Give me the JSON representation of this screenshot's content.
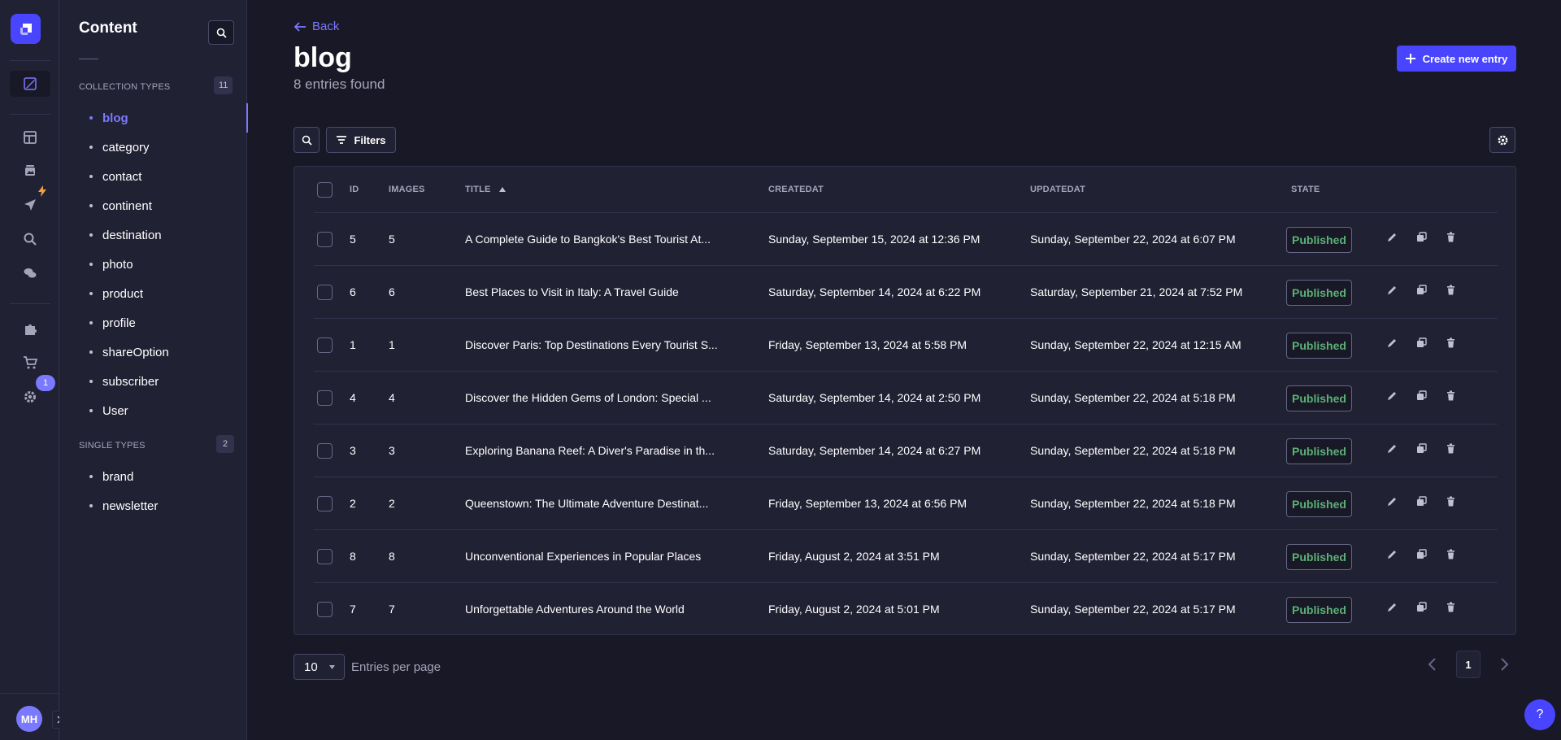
{
  "rail": {
    "badge": "1",
    "avatar_initials": "MH"
  },
  "sidebar": {
    "title": "Content",
    "collection_types_label": "COLLECTION TYPES",
    "collection_types_count": "11",
    "collection_types": [
      "blog",
      "category",
      "contact",
      "continent",
      "destination",
      "photo",
      "product",
      "profile",
      "shareOption",
      "subscriber",
      "User"
    ],
    "single_types_label": "SINGLE TYPES",
    "single_types_count": "2",
    "single_types": [
      "brand",
      "newsletter"
    ],
    "active_item": "blog"
  },
  "header": {
    "back_label": "Back",
    "title": "blog",
    "subtitle": "8 entries found",
    "create_label": "Create new entry"
  },
  "toolbar": {
    "filters_label": "Filters"
  },
  "table": {
    "columns": [
      "ID",
      "IMAGES",
      "TITLE",
      "CREATEDAT",
      "UPDATEDAT",
      "STATE"
    ],
    "rows": [
      {
        "id": "5",
        "images": "5",
        "title": "A Complete Guide to Bangkok's Best Tourist At...",
        "created": "Sunday, September 15, 2024 at 12:36 PM",
        "updated": "Sunday, September 22, 2024 at 6:07 PM",
        "state": "Published"
      },
      {
        "id": "6",
        "images": "6",
        "title": "Best Places to Visit in Italy: A Travel Guide",
        "created": "Saturday, September 14, 2024 at 6:22 PM",
        "updated": "Saturday, September 21, 2024 at 7:52 PM",
        "state": "Published"
      },
      {
        "id": "1",
        "images": "1",
        "title": "Discover Paris: Top Destinations Every Tourist S...",
        "created": "Friday, September 13, 2024 at 5:58 PM",
        "updated": "Sunday, September 22, 2024 at 12:15 AM",
        "state": "Published"
      },
      {
        "id": "4",
        "images": "4",
        "title": "Discover the Hidden Gems of London: Special ...",
        "created": "Saturday, September 14, 2024 at 2:50 PM",
        "updated": "Sunday, September 22, 2024 at 5:18 PM",
        "state": "Published"
      },
      {
        "id": "3",
        "images": "3",
        "title": "Exploring Banana Reef: A Diver's Paradise in th...",
        "created": "Saturday, September 14, 2024 at 6:27 PM",
        "updated": "Sunday, September 22, 2024 at 5:18 PM",
        "state": "Published"
      },
      {
        "id": "2",
        "images": "2",
        "title": "Queenstown: The Ultimate Adventure Destinat...",
        "created": "Friday, September 13, 2024 at 6:56 PM",
        "updated": "Sunday, September 22, 2024 at 5:18 PM",
        "state": "Published"
      },
      {
        "id": "8",
        "images": "8",
        "title": "Unconventional Experiences in Popular Places",
        "created": "Friday, August 2, 2024 at 3:51 PM",
        "updated": "Sunday, September 22, 2024 at 5:17 PM",
        "state": "Published"
      },
      {
        "id": "7",
        "images": "7",
        "title": "Unforgettable Adventures Around the World",
        "created": "Friday, August 2, 2024 at 5:01 PM",
        "updated": "Sunday, September 22, 2024 at 5:17 PM",
        "state": "Published"
      }
    ]
  },
  "pagination": {
    "per_page": "10",
    "per_page_label": "Entries per page",
    "current_page": "1"
  },
  "help": {
    "label": "?"
  },
  "colors": {
    "accent": "#4945ff",
    "accent_light": "#7b79ff",
    "published": "#5cb176",
    "background": "#181826",
    "surface": "#212134"
  }
}
